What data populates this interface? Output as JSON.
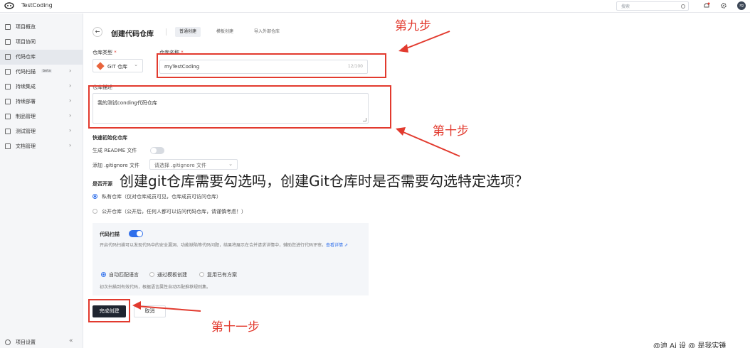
{
  "topbar": {
    "project_name": "TestCoding",
    "search_placeholder": "搜索",
    "avatar_text": "zg"
  },
  "sidebar": {
    "items": [
      {
        "label": "项目概览",
        "icon": "home-icon"
      },
      {
        "label": "项目协同",
        "icon": "checklist-icon"
      },
      {
        "label": "代码仓库",
        "icon": "code-icon",
        "active": true
      },
      {
        "label": "代码扫描",
        "icon": "scan-icon",
        "badge": "beta"
      },
      {
        "label": "持续集成",
        "icon": "infinity-icon"
      },
      {
        "label": "持续部署",
        "icon": "deploy-icon"
      },
      {
        "label": "制品管理",
        "icon": "package-icon"
      },
      {
        "label": "测试管理",
        "icon": "test-icon"
      },
      {
        "label": "文档管理",
        "icon": "doc-icon"
      }
    ],
    "settings_label": "项目设置"
  },
  "header": {
    "title": "创建代码仓库",
    "tabs": [
      "普通创建",
      "模板创建",
      "导入外部仓库"
    ]
  },
  "form": {
    "repo_type_label": "仓库类型",
    "repo_type_value": "GIT 仓库",
    "repo_name_label": "仓库名称",
    "repo_name_value": "myTestCoding",
    "repo_name_count": "12/100",
    "desc_label": "仓库描述",
    "desc_value": "我的测试conding代码仓库",
    "quick_init_label": "快速初始化仓库",
    "readme_label": "生成 README 文件",
    "gitignore_label": "添加 .gitignore 文件",
    "gitignore_placeholder": "请选择 .gitignore 文件",
    "open_source_label": "是否开源",
    "private_option": "私有仓库（仅对仓库成员可见，仓库成员可访问仓库）",
    "public_option": "公开仓库（公开后，任何人都可以访问代码仓库，请谨慎考虑！）"
  },
  "scan": {
    "title": "代码扫描",
    "description": "开启代码扫描可以发现代码中的安全漏洞、功能缺陷等代码问题，结果将展示在合并请求详情中，辅助您进行代码评审。",
    "link": "查看详情",
    "options": [
      "自动匹配语言",
      "通过模板创建",
      "复用已有方案"
    ],
    "footnote": "初次扫描到有效代码，根据语言属性自动匹配推荐规则集。"
  },
  "actions": {
    "submit": "完成创建",
    "cancel": "取消"
  },
  "annotations": {
    "step9": "第九步",
    "step10": "第十步",
    "step11": "第十一步",
    "overlay": "创建git仓库需要勾选吗，创建Git仓库时是否需要勾选特定选项？",
    "watermark": "@迪 Ai 设 @ 是我实锤",
    "color": "#e23a2e"
  }
}
